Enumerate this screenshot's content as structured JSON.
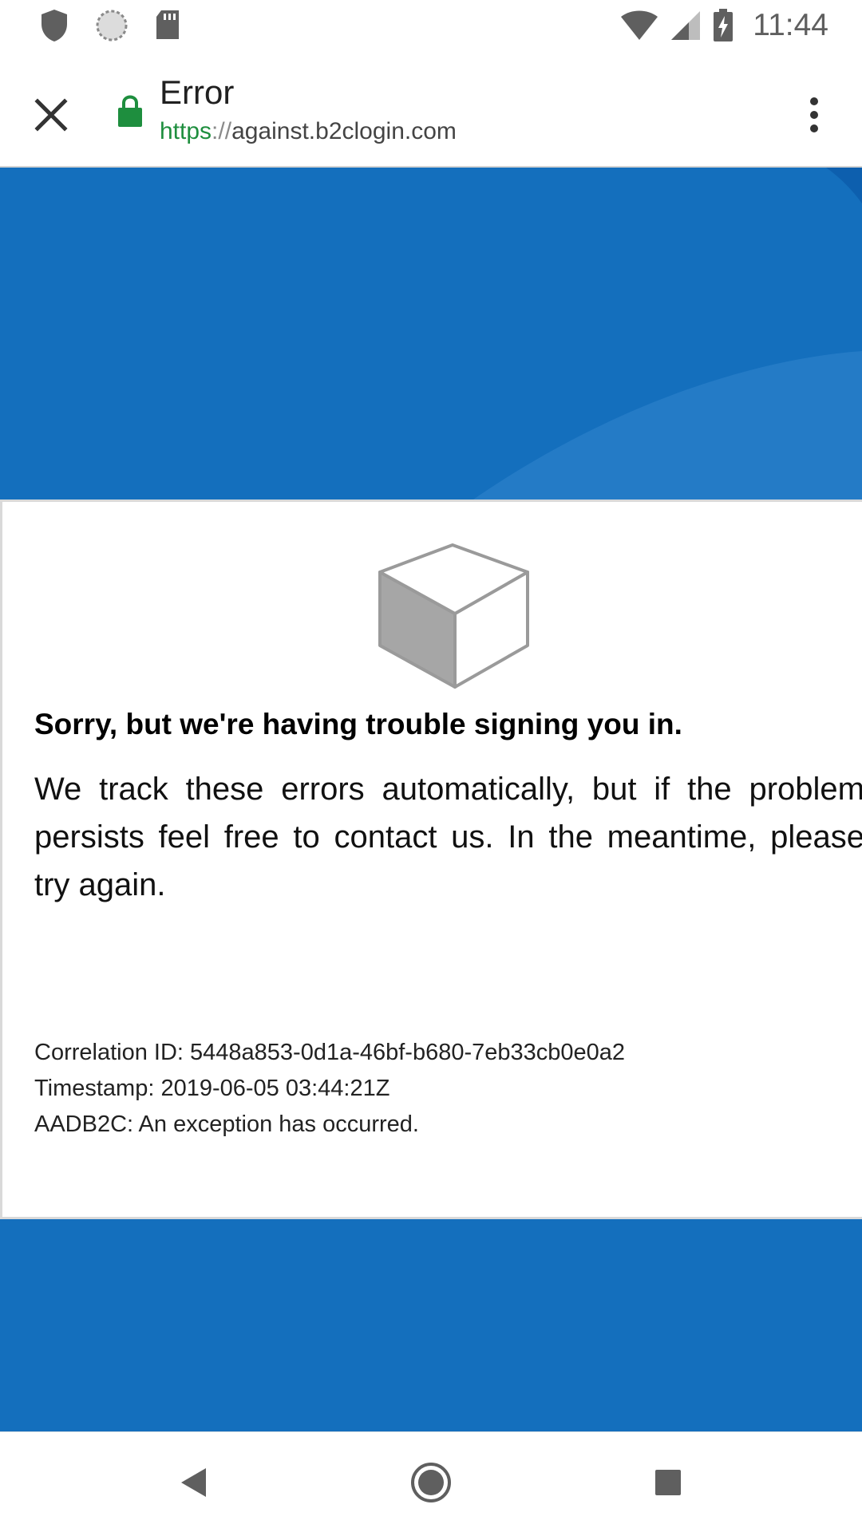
{
  "status_bar": {
    "time": "11:44",
    "left_icons": [
      "shield-icon",
      "sync-circle-icon",
      "sd-card-icon"
    ],
    "right_icons": [
      "wifi-icon",
      "cell-signal-icon",
      "battery-charging-icon"
    ]
  },
  "toolbar": {
    "title": "Error",
    "url_scheme": "https",
    "url_separator": "://",
    "url_host": "against.b2clogin.com",
    "lock_color": "#1e8e3e"
  },
  "page": {
    "heading": "Sorry, but we're having trouble signing you in.",
    "message_lines": [
      "We track these errors automatically, but if the problem",
      "persists feel free to contact us. In the meantime, please",
      "try again."
    ],
    "details": {
      "correlation_id": "Correlation ID: 5448a853-0d1a-46bf-b680-7eb33cb0e0a2",
      "timestamp": "Timestamp: 2019-06-05 03:44:21Z",
      "error": "AADB2C: An exception has occurred."
    },
    "background_color": "#146fbd"
  },
  "nav_bar": {
    "buttons": [
      "back-icon",
      "home-icon",
      "recents-icon"
    ]
  }
}
